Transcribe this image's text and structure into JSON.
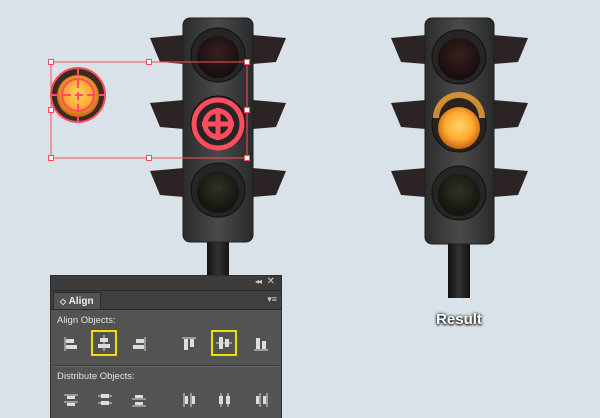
{
  "panel": {
    "tab_label": "Align",
    "tab_arrow": "◇",
    "collapse_glyph": "◂◂",
    "close_glyph": "✕",
    "menu_glyph": "▾≡",
    "align_objects_label": "Align Objects:",
    "distribute_objects_label": "Distribute Objects:",
    "align_buttons": [
      {
        "icon": "horizontal-align-left-icon",
        "selected": false
      },
      {
        "icon": "horizontal-align-center-icon",
        "selected": true
      },
      {
        "icon": "horizontal-align-right-icon",
        "selected": false
      },
      {
        "icon": "vertical-align-top-icon",
        "selected": false
      },
      {
        "icon": "vertical-align-center-icon",
        "selected": true
      },
      {
        "icon": "vertical-align-bottom-icon",
        "selected": false
      }
    ],
    "distribute_buttons": [
      {
        "icon": "vertical-distribute-top-icon"
      },
      {
        "icon": "vertical-distribute-center-icon"
      },
      {
        "icon": "vertical-distribute-bottom-icon"
      },
      {
        "icon": "horizontal-distribute-left-icon"
      },
      {
        "icon": "horizontal-distribute-center-icon"
      },
      {
        "icon": "horizontal-distribute-right-icon"
      }
    ],
    "highlight_color": "#f0e000"
  },
  "canvas": {
    "selection_color": "#ff4d5e",
    "amber_lamp_color": "#ffb24a",
    "housing_color": "#3a3a3a"
  },
  "result_label": "Result"
}
